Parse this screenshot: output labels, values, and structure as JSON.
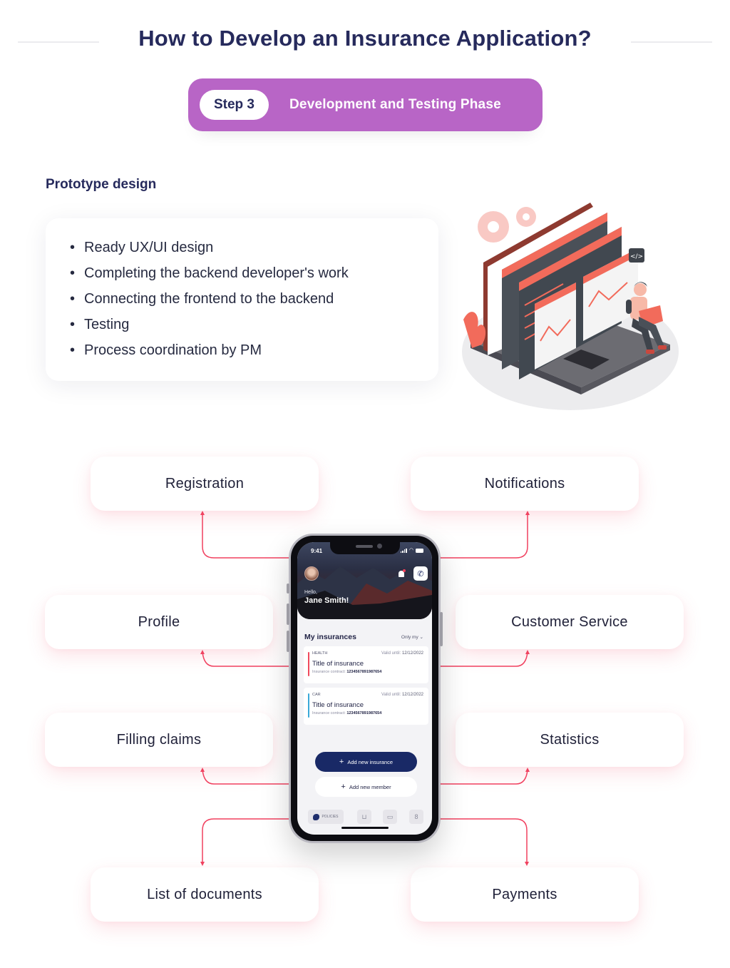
{
  "header": {
    "title": "How to Develop an Insurance Application?",
    "step_badge": "Step 3",
    "step_label": "Development and Testing Phase",
    "accent_color": "#b865c6"
  },
  "prototype": {
    "title": "Prototype design",
    "bullets": [
      "Ready UX/UI design",
      "Completing the backend developer's work",
      "Connecting the frontend to the backend",
      "Testing",
      "Process coordination by PM"
    ]
  },
  "illustration": {
    "name": "developer-with-laptop-and-web-windows",
    "code_tag": "</>"
  },
  "features": {
    "registration": "Registration",
    "notifications": "Notifications",
    "profile": "Profile",
    "customer_service": "Customer Service",
    "filling_claims": "Filling claims",
    "statistics": "Statistics",
    "list_of_documents": "List of documents",
    "payments": "Payments",
    "connector_color": "#f1405f"
  },
  "phone": {
    "status_time": "9:41",
    "greeting": "Hello,",
    "user_name": "Jane Smith!",
    "section_title": "My insurances",
    "filter": "Only my",
    "cards": [
      {
        "type": "HEALTH",
        "valid_label": "Valid until:",
        "valid_date": "12/12/2022",
        "title": "Title of insurance",
        "contract_label": "Insurance contract:",
        "contract_number": "1234567891987654",
        "color": "#f0495d"
      },
      {
        "type": "CAR",
        "valid_label": "Valid until:",
        "valid_date": "12/12/2022",
        "title": "Title of insurance",
        "contract_label": "Insurance contract:",
        "contract_number": "1234567891987654",
        "color": "#3aa8d8"
      }
    ],
    "add_insurance": "Add new insurance",
    "add_member": "Add new member",
    "tabs": {
      "policies": "POLICIES",
      "basket": "basket-icon",
      "chat": "chat-icon",
      "profile": "user-icon"
    }
  }
}
